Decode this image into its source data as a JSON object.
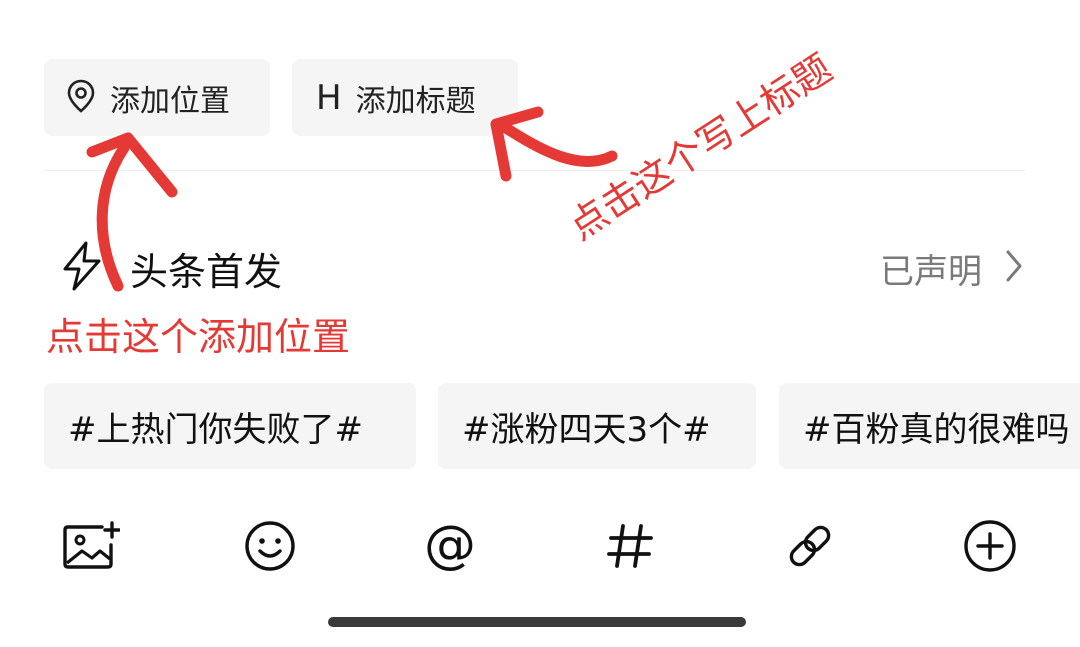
{
  "chips": {
    "location": {
      "label": "添加位置",
      "icon": "location-pin-icon"
    },
    "title": {
      "label": "添加标题",
      "icon": "heading-icon",
      "glyph": "H"
    }
  },
  "first_publish": {
    "icon": "lightning-icon",
    "label": "头条首发",
    "status": "已声明",
    "chevron": "chevron-right-icon"
  },
  "tags": [
    "#上热门你失败了#",
    "#涨粉四天3个#",
    "#百粉真的很难吗"
  ],
  "toolbar": {
    "icons": [
      "image-add-icon",
      "emoji-icon",
      "at-icon",
      "hash-icon",
      "link-icon",
      "add-circle-icon"
    ],
    "at_glyph": "@",
    "hash_glyph": "#"
  },
  "annotations": {
    "location_note": "点击这个添加位置",
    "title_note": "点击这个写上标题",
    "color": "#e53935"
  }
}
